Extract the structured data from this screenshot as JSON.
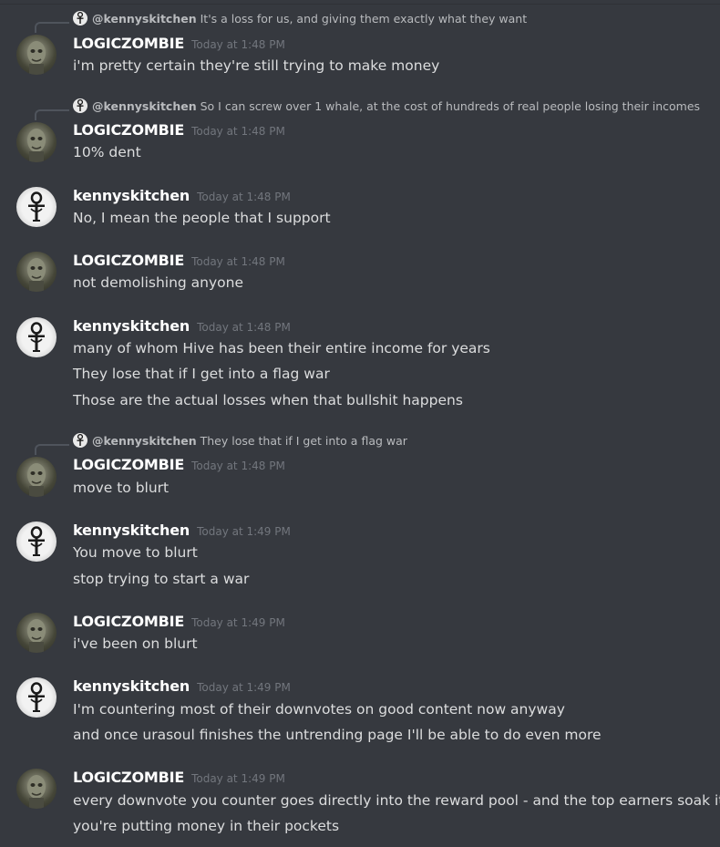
{
  "messages": [
    {
      "reply": {
        "author": "@kennyskitchen",
        "text": "It's a loss for us, and giving them exactly what they want"
      },
      "author": "LOGICZOMBIE",
      "avatar": "zombie-avatar",
      "timestamp": "Today at 1:48 PM",
      "lines": [
        "i'm pretty certain they're still trying to make money"
      ]
    },
    {
      "reply": {
        "author": "@kennyskitchen",
        "text": "So I can screw over 1 whale, at the cost of hundreds of real people losing their incomes"
      },
      "author": "LOGICZOMBIE",
      "avatar": "zombie-avatar",
      "timestamp": "Today at 1:48 PM",
      "lines": [
        "10% dent"
      ]
    },
    {
      "author": "kennyskitchen",
      "avatar": "ankh-avatar",
      "timestamp": "Today at 1:48 PM",
      "lines": [
        "No, I mean the people that I support"
      ]
    },
    {
      "author": "LOGICZOMBIE",
      "avatar": "zombie-avatar",
      "timestamp": "Today at 1:48 PM",
      "lines": [
        "not demolishing anyone"
      ]
    },
    {
      "author": "kennyskitchen",
      "avatar": "ankh-avatar",
      "timestamp": "Today at 1:48 PM",
      "lines": [
        "many of whom Hive has been their entire income for years",
        "They lose that if I get into a flag war",
        "Those are the actual losses when that bullshit happens"
      ]
    },
    {
      "reply": {
        "author": "@kennyskitchen",
        "text": "They lose that if I get into a flag war"
      },
      "author": "LOGICZOMBIE",
      "avatar": "zombie-avatar",
      "timestamp": "Today at 1:48 PM",
      "lines": [
        "move to blurt"
      ]
    },
    {
      "author": "kennyskitchen",
      "avatar": "ankh-avatar",
      "timestamp": "Today at 1:49 PM",
      "lines": [
        "You move to blurt",
        "stop trying to start a war"
      ]
    },
    {
      "author": "LOGICZOMBIE",
      "avatar": "zombie-avatar",
      "timestamp": "Today at 1:49 PM",
      "lines": [
        "i've been on blurt"
      ]
    },
    {
      "author": "kennyskitchen",
      "avatar": "ankh-avatar",
      "timestamp": "Today at 1:49 PM",
      "lines": [
        "I'm countering most of their downvotes on good content now anyway",
        "and once urasoul finishes the untrending page I'll be able to do even more"
      ]
    },
    {
      "author": "LOGICZOMBIE",
      "avatar": "zombie-avatar",
      "timestamp": "Today at 1:49 PM",
      "lines": [
        "every downvote you counter goes directly into the reward pool - and the top earners soak it up",
        "you're putting money in their pockets"
      ]
    }
  ]
}
